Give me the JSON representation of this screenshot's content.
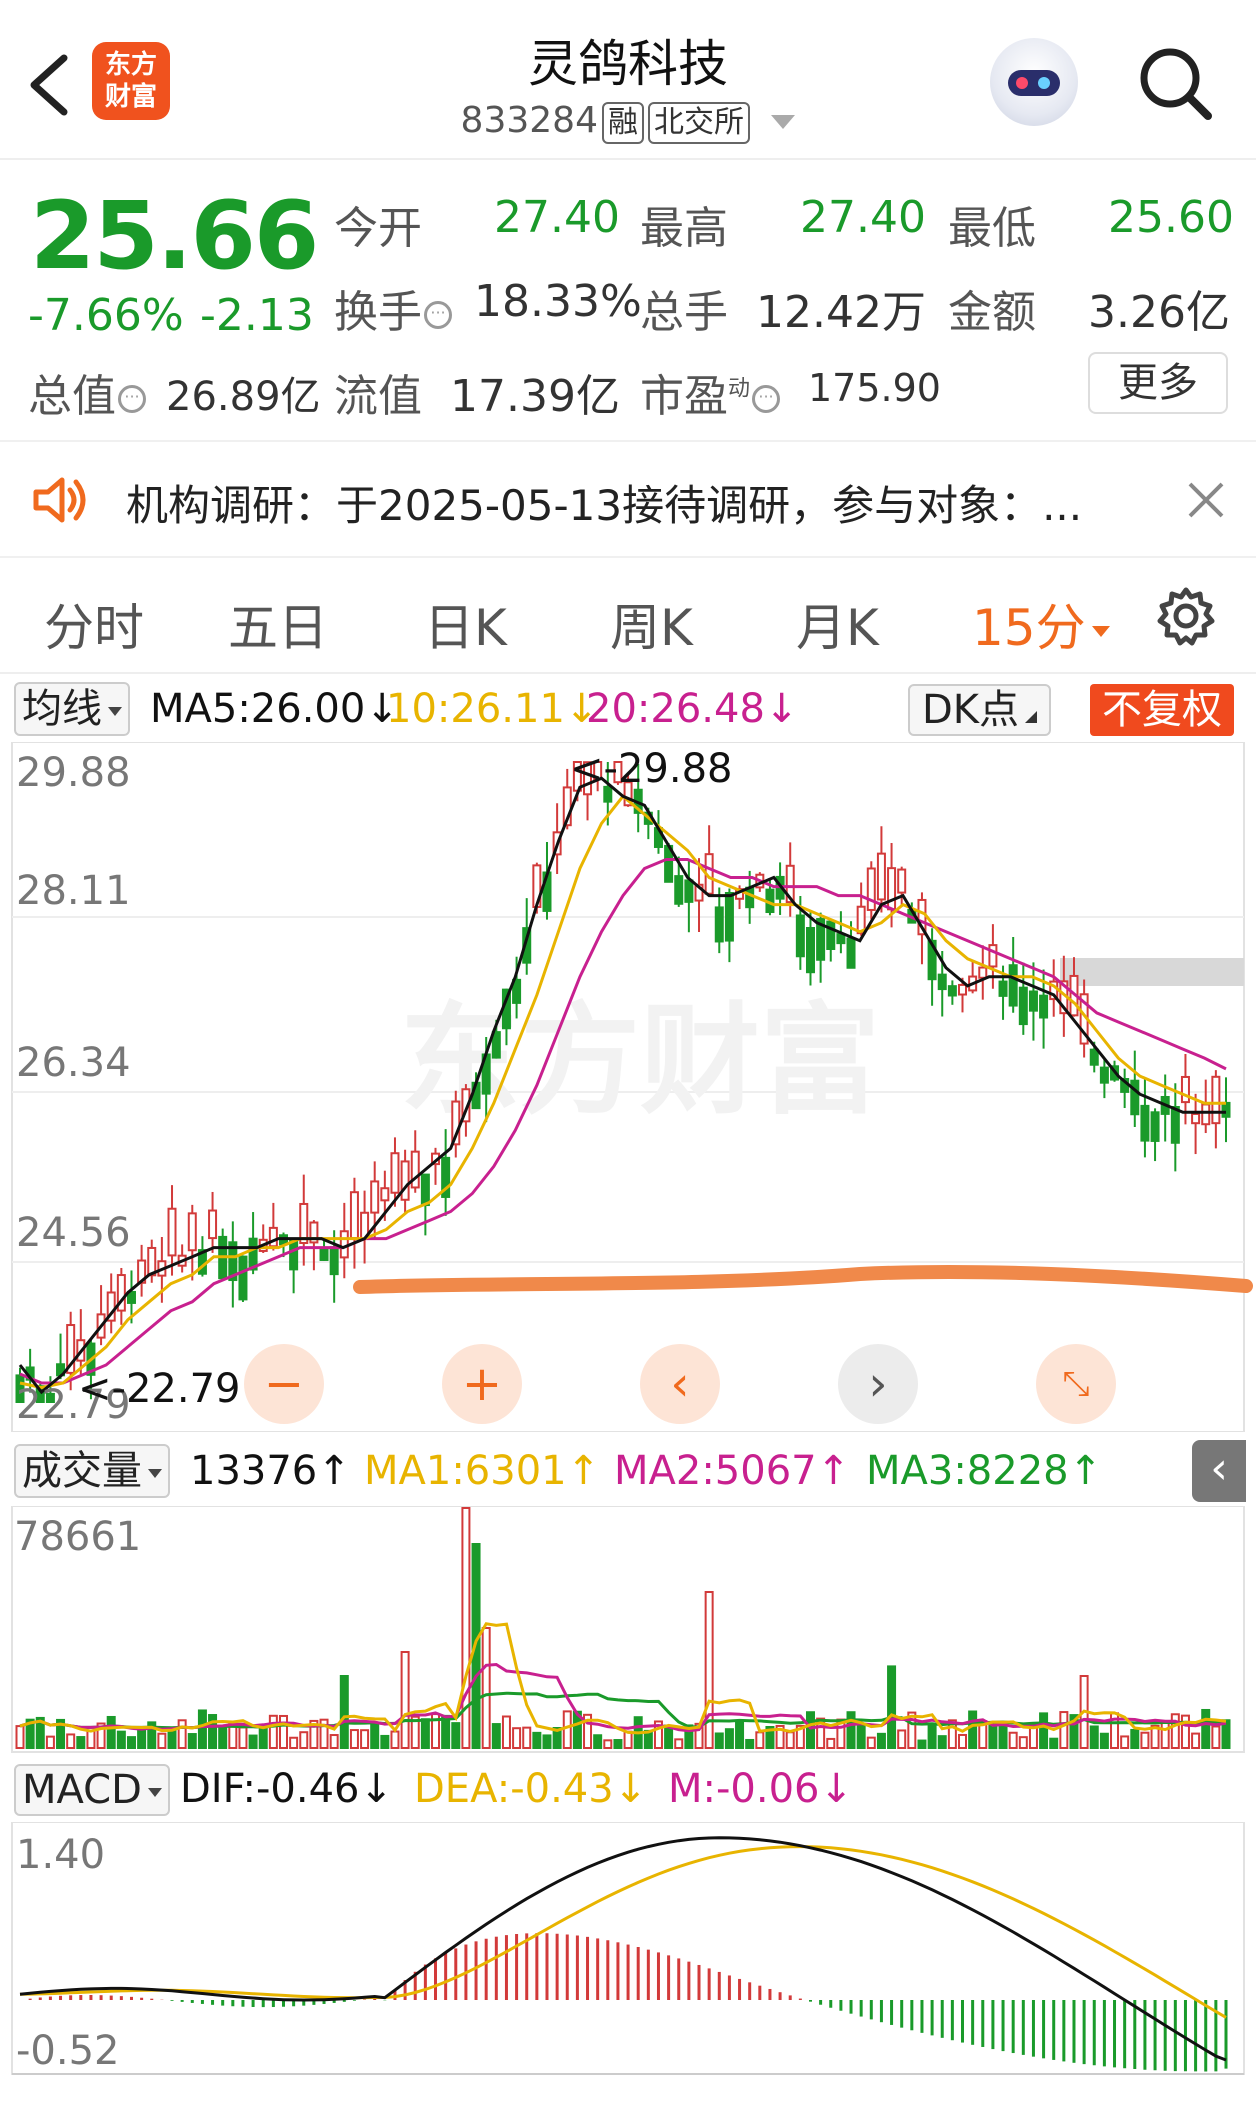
{
  "header": {
    "title": "灵鸽科技",
    "code": "833284",
    "tag_rong": "融",
    "tag_exchange": "北交所",
    "logo_line1": "东方",
    "logo_line2": "财富"
  },
  "quote": {
    "price": "25.66",
    "change_pct": "-7.66%",
    "change": "-2.13",
    "open_label": "今开",
    "open": "27.40",
    "high_label": "最高",
    "high": "27.40",
    "low_label": "最低",
    "low": "25.60",
    "turnover_label": "换手",
    "turnover": "18.33%",
    "volume_label": "总手",
    "volume": "12.42万",
    "amount_label": "金额",
    "amount": "3.26亿",
    "mktcap_label": "总值",
    "mktcap": "26.89亿",
    "float_label": "流值",
    "float": "17.39亿",
    "pe_label": "市盈",
    "pe_sup": "动",
    "pe": "175.90",
    "more_label": "更多"
  },
  "notice": {
    "text": "机构调研：于2025-05-13接待调研，参与对象：..."
  },
  "tabs": [
    "分时",
    "五日",
    "日K",
    "周K",
    "月K",
    "15分"
  ],
  "active_tab": "15分",
  "main_chart": {
    "ma_selector": "均线",
    "ma5": "MA5:26.00",
    "ma10": "10:26.11",
    "ma20": "20:26.48",
    "dk_label": "DK点",
    "fq_label": "不复权",
    "y_labels": [
      "29.88",
      "28.11",
      "26.34",
      "24.56",
      "22.79"
    ],
    "high_mark": "29.88",
    "low_mark": "22.79",
    "watermark": "东方财富"
  },
  "volume_chart": {
    "selector": "成交量",
    "vol": "13376",
    "ma1": "MA1:6301",
    "ma2": "MA2:5067",
    "ma3": "MA3:8228",
    "y_max": "78661"
  },
  "macd_chart": {
    "selector": "MACD",
    "dif": "DIF:-0.46",
    "dea": "DEA:-0.43",
    "m": "M:-0.06",
    "y_top": "1.40",
    "y_bottom": "-0.52"
  },
  "colors": {
    "up": "#d23a3a",
    "down": "#1a9a2a",
    "ma5": "#111111",
    "ma10": "#e8b400",
    "ma20": "#c8208f",
    "accent": "#f06a1e"
  },
  "chart_data": {
    "type": "candlestick",
    "ylim": [
      22.79,
      29.88
    ],
    "ma5_path": [
      23.2,
      22.9,
      23.1,
      23.4,
      23.7,
      24.0,
      24.2,
      24.3,
      24.4,
      24.5,
      24.5,
      24.5,
      24.6,
      24.6,
      24.6,
      24.5,
      24.6,
      24.9,
      25.2,
      25.4,
      25.6,
      26.2,
      26.9,
      27.5,
      28.3,
      29.0,
      29.6,
      29.7,
      29.5,
      29.4,
      29.0,
      28.6,
      28.4,
      28.4,
      28.5,
      28.6,
      28.3,
      28.1,
      28.0,
      27.9,
      28.3,
      28.4,
      28.0,
      27.6,
      27.4,
      27.5,
      27.5,
      27.4,
      27.3,
      27.0,
      26.7,
      26.4,
      26.2,
      26.1,
      26.0,
      26.0,
      26.0
    ],
    "ma10_path": [
      23.0,
      22.95,
      23.0,
      23.2,
      23.4,
      23.7,
      23.9,
      24.1,
      24.2,
      24.4,
      24.4,
      24.5,
      24.5,
      24.6,
      24.6,
      24.6,
      24.6,
      24.7,
      24.9,
      25.0,
      25.2,
      25.6,
      26.1,
      26.7,
      27.3,
      28.0,
      28.7,
      29.2,
      29.5,
      29.3,
      29.1,
      28.9,
      28.6,
      28.5,
      28.4,
      28.3,
      28.3,
      28.2,
      28.1,
      28.0,
      28.1,
      28.3,
      28.2,
      27.9,
      27.7,
      27.6,
      27.5,
      27.5,
      27.4,
      27.2,
      26.9,
      26.6,
      26.4,
      26.3,
      26.2,
      26.1,
      26.1
    ],
    "ma20_path": [
      23.1,
      23.0,
      23.0,
      23.1,
      23.2,
      23.4,
      23.6,
      23.8,
      23.9,
      24.1,
      24.2,
      24.3,
      24.4,
      24.5,
      24.5,
      24.5,
      24.6,
      24.6,
      24.7,
      24.8,
      24.9,
      25.1,
      25.4,
      25.8,
      26.3,
      26.9,
      27.5,
      28.0,
      28.4,
      28.7,
      28.8,
      28.8,
      28.7,
      28.6,
      28.6,
      28.5,
      28.5,
      28.5,
      28.4,
      28.4,
      28.3,
      28.2,
      28.1,
      28.0,
      27.9,
      27.8,
      27.7,
      27.6,
      27.5,
      27.3,
      27.1,
      27.0,
      26.9,
      26.8,
      26.7,
      26.6,
      26.48
    ]
  }
}
